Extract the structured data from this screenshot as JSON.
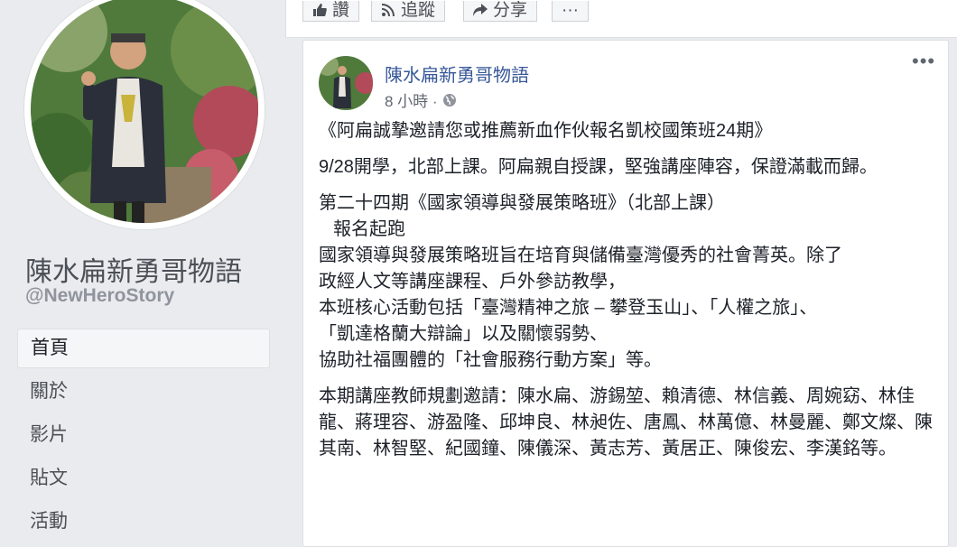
{
  "page": {
    "name": "陳水扁新勇哥物語",
    "handle": "@NewHeroStory"
  },
  "sidebar": {
    "items": [
      {
        "label": "首頁",
        "active": true
      },
      {
        "label": "關於"
      },
      {
        "label": "影片"
      },
      {
        "label": "貼文"
      },
      {
        "label": "活動"
      }
    ]
  },
  "action_bar": {
    "like_label": "讚",
    "follow_label": "追蹤",
    "share_label": "分享",
    "more_label": "···"
  },
  "post": {
    "author": "陳水扁新勇哥物語",
    "time": "8 小時 ·",
    "privacy_icon": "globe-icon",
    "menu_label": "•••",
    "title": "《阿扁誠摯邀請您或推薦新血作伙報名凱校國策班24期》",
    "intro": "9/28開學，北部上課。阿扁親自授課，堅強講座陣容，保證滿載而歸。",
    "section_heading": "第二十四期《國家領導與發展策略班》（北部上課）",
    "signup_line": "報名起跑",
    "description_lines": [
      "國家領導與發展策略班旨在培育與儲備臺灣優秀的社會菁英。除了",
      "政經人文等講座課程、戶外參訪教學，",
      "本班核心活動包括「臺灣精神之旅 – 攀登玉山」、「人權之旅」、",
      "「凱達格蘭大辯論」以及關懷弱勢、",
      "協助社福團體的「社會服務行動方案」等。"
    ],
    "lecturers": "本期講座教師規劃邀請：陳水扁、游錫堃、賴清德、林信義、周婉窈、林佳龍、蔣理容、游盈隆、邱坤良、林昶佐、唐鳳、林萬億、林曼麗、鄭文燦、陳其南、林智堅、紀國鐘、陳儀深、黃志芳、黃居正、陳俊宏、李漢銘等。"
  },
  "colors": {
    "background": "#e9ebee",
    "link": "#385898",
    "text": "#1d2129",
    "muted": "#616770"
  }
}
